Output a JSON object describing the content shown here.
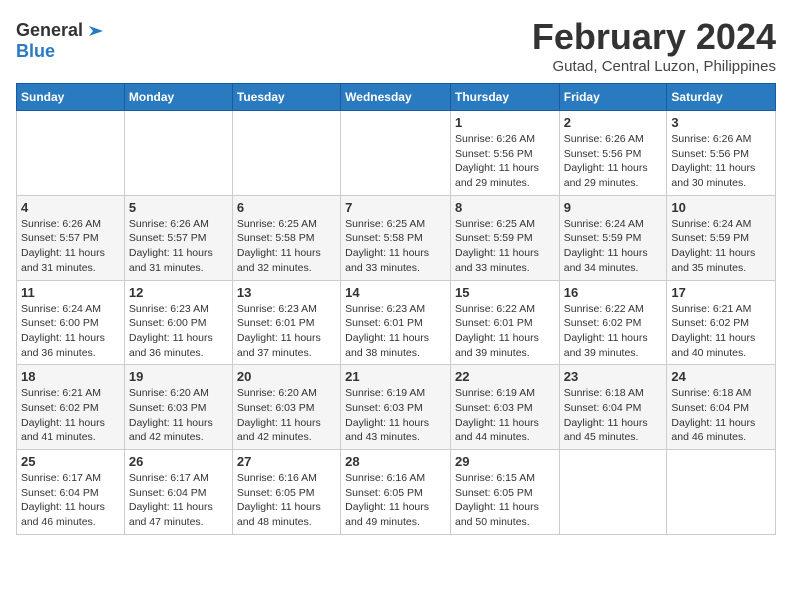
{
  "logo": {
    "general": "General",
    "blue": "Blue"
  },
  "title": "February 2024",
  "location": "Gutad, Central Luzon, Philippines",
  "days_header": [
    "Sunday",
    "Monday",
    "Tuesday",
    "Wednesday",
    "Thursday",
    "Friday",
    "Saturday"
  ],
  "weeks": [
    [
      {
        "num": "",
        "info": ""
      },
      {
        "num": "",
        "info": ""
      },
      {
        "num": "",
        "info": ""
      },
      {
        "num": "",
        "info": ""
      },
      {
        "num": "1",
        "info": "Sunrise: 6:26 AM\nSunset: 5:56 PM\nDaylight: 11 hours and 29 minutes."
      },
      {
        "num": "2",
        "info": "Sunrise: 6:26 AM\nSunset: 5:56 PM\nDaylight: 11 hours and 29 minutes."
      },
      {
        "num": "3",
        "info": "Sunrise: 6:26 AM\nSunset: 5:56 PM\nDaylight: 11 hours and 30 minutes."
      }
    ],
    [
      {
        "num": "4",
        "info": "Sunrise: 6:26 AM\nSunset: 5:57 PM\nDaylight: 11 hours and 31 minutes."
      },
      {
        "num": "5",
        "info": "Sunrise: 6:26 AM\nSunset: 5:57 PM\nDaylight: 11 hours and 31 minutes."
      },
      {
        "num": "6",
        "info": "Sunrise: 6:25 AM\nSunset: 5:58 PM\nDaylight: 11 hours and 32 minutes."
      },
      {
        "num": "7",
        "info": "Sunrise: 6:25 AM\nSunset: 5:58 PM\nDaylight: 11 hours and 33 minutes."
      },
      {
        "num": "8",
        "info": "Sunrise: 6:25 AM\nSunset: 5:59 PM\nDaylight: 11 hours and 33 minutes."
      },
      {
        "num": "9",
        "info": "Sunrise: 6:24 AM\nSunset: 5:59 PM\nDaylight: 11 hours and 34 minutes."
      },
      {
        "num": "10",
        "info": "Sunrise: 6:24 AM\nSunset: 5:59 PM\nDaylight: 11 hours and 35 minutes."
      }
    ],
    [
      {
        "num": "11",
        "info": "Sunrise: 6:24 AM\nSunset: 6:00 PM\nDaylight: 11 hours and 36 minutes."
      },
      {
        "num": "12",
        "info": "Sunrise: 6:23 AM\nSunset: 6:00 PM\nDaylight: 11 hours and 36 minutes."
      },
      {
        "num": "13",
        "info": "Sunrise: 6:23 AM\nSunset: 6:01 PM\nDaylight: 11 hours and 37 minutes."
      },
      {
        "num": "14",
        "info": "Sunrise: 6:23 AM\nSunset: 6:01 PM\nDaylight: 11 hours and 38 minutes."
      },
      {
        "num": "15",
        "info": "Sunrise: 6:22 AM\nSunset: 6:01 PM\nDaylight: 11 hours and 39 minutes."
      },
      {
        "num": "16",
        "info": "Sunrise: 6:22 AM\nSunset: 6:02 PM\nDaylight: 11 hours and 39 minutes."
      },
      {
        "num": "17",
        "info": "Sunrise: 6:21 AM\nSunset: 6:02 PM\nDaylight: 11 hours and 40 minutes."
      }
    ],
    [
      {
        "num": "18",
        "info": "Sunrise: 6:21 AM\nSunset: 6:02 PM\nDaylight: 11 hours and 41 minutes."
      },
      {
        "num": "19",
        "info": "Sunrise: 6:20 AM\nSunset: 6:03 PM\nDaylight: 11 hours and 42 minutes."
      },
      {
        "num": "20",
        "info": "Sunrise: 6:20 AM\nSunset: 6:03 PM\nDaylight: 11 hours and 42 minutes."
      },
      {
        "num": "21",
        "info": "Sunrise: 6:19 AM\nSunset: 6:03 PM\nDaylight: 11 hours and 43 minutes."
      },
      {
        "num": "22",
        "info": "Sunrise: 6:19 AM\nSunset: 6:03 PM\nDaylight: 11 hours and 44 minutes."
      },
      {
        "num": "23",
        "info": "Sunrise: 6:18 AM\nSunset: 6:04 PM\nDaylight: 11 hours and 45 minutes."
      },
      {
        "num": "24",
        "info": "Sunrise: 6:18 AM\nSunset: 6:04 PM\nDaylight: 11 hours and 46 minutes."
      }
    ],
    [
      {
        "num": "25",
        "info": "Sunrise: 6:17 AM\nSunset: 6:04 PM\nDaylight: 11 hours and 46 minutes."
      },
      {
        "num": "26",
        "info": "Sunrise: 6:17 AM\nSunset: 6:04 PM\nDaylight: 11 hours and 47 minutes."
      },
      {
        "num": "27",
        "info": "Sunrise: 6:16 AM\nSunset: 6:05 PM\nDaylight: 11 hours and 48 minutes."
      },
      {
        "num": "28",
        "info": "Sunrise: 6:16 AM\nSunset: 6:05 PM\nDaylight: 11 hours and 49 minutes."
      },
      {
        "num": "29",
        "info": "Sunrise: 6:15 AM\nSunset: 6:05 PM\nDaylight: 11 hours and 50 minutes."
      },
      {
        "num": "",
        "info": ""
      },
      {
        "num": "",
        "info": ""
      }
    ]
  ]
}
